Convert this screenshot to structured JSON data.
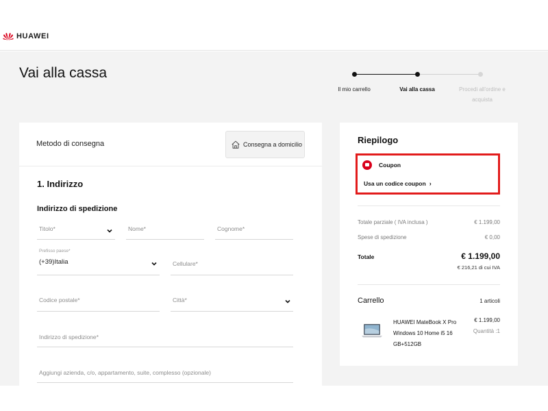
{
  "brand": {
    "name": "HUAWEI",
    "accent": "#d9001b"
  },
  "page": {
    "title": "Vai alla cassa"
  },
  "steps": [
    {
      "label": "Il mio carrello",
      "state": "done"
    },
    {
      "label": "Vai alla cassa",
      "state": "current"
    },
    {
      "label": "Procedi all'ordine e acquista",
      "state": "upcoming"
    }
  ],
  "delivery": {
    "label": "Metodo di consegna",
    "option": "Consegna a domicilio",
    "icon": "home-icon"
  },
  "address": {
    "section_title": "1. Indirizzo",
    "subtitle": "Indirizzo di spedizione",
    "title_placeholder": "Titolo*",
    "first_name_placeholder": "Nome*",
    "last_name_placeholder": "Cognome*",
    "prefix_label": "Prefisso paese*",
    "prefix_value": "(+39)Italia",
    "phone_placeholder": "Cellulare*",
    "postal_placeholder": "Codice postale*",
    "city_placeholder": "Città*",
    "address_placeholder": "Indirizzo di spedizione*",
    "extra_placeholder": "Aggiungi azienda, c/o, appartamento, suite, complesso (opzionale)"
  },
  "summary": {
    "title": "Riepilogo",
    "coupon_label": "Coupon",
    "coupon_link": "Usa un codice coupon",
    "coupon_arrow": "›",
    "subtotal_label": "Totale parziale ( IVA inclusa )",
    "subtotal_value": "€ 1.199,00",
    "shipping_label": "Spese di spedizione",
    "shipping_value": "€ 0,00",
    "total_label": "Totale",
    "total_value": "€ 1.199,00",
    "vat_note": "€ 216,21 di cui IVA"
  },
  "cart": {
    "title": "Carrello",
    "count": "1 articoli",
    "item": {
      "name": "HUAWEI MateBook X Pro Windows 10 Home i5 16 GB+512GB",
      "price": "€ 1.199,00",
      "quantity": "Quantità :1"
    }
  },
  "colors": {
    "highlight": "#e21b1b",
    "background": "#f3f3f3",
    "text": "#1a1a1a",
    "muted": "#8c8c8c"
  }
}
